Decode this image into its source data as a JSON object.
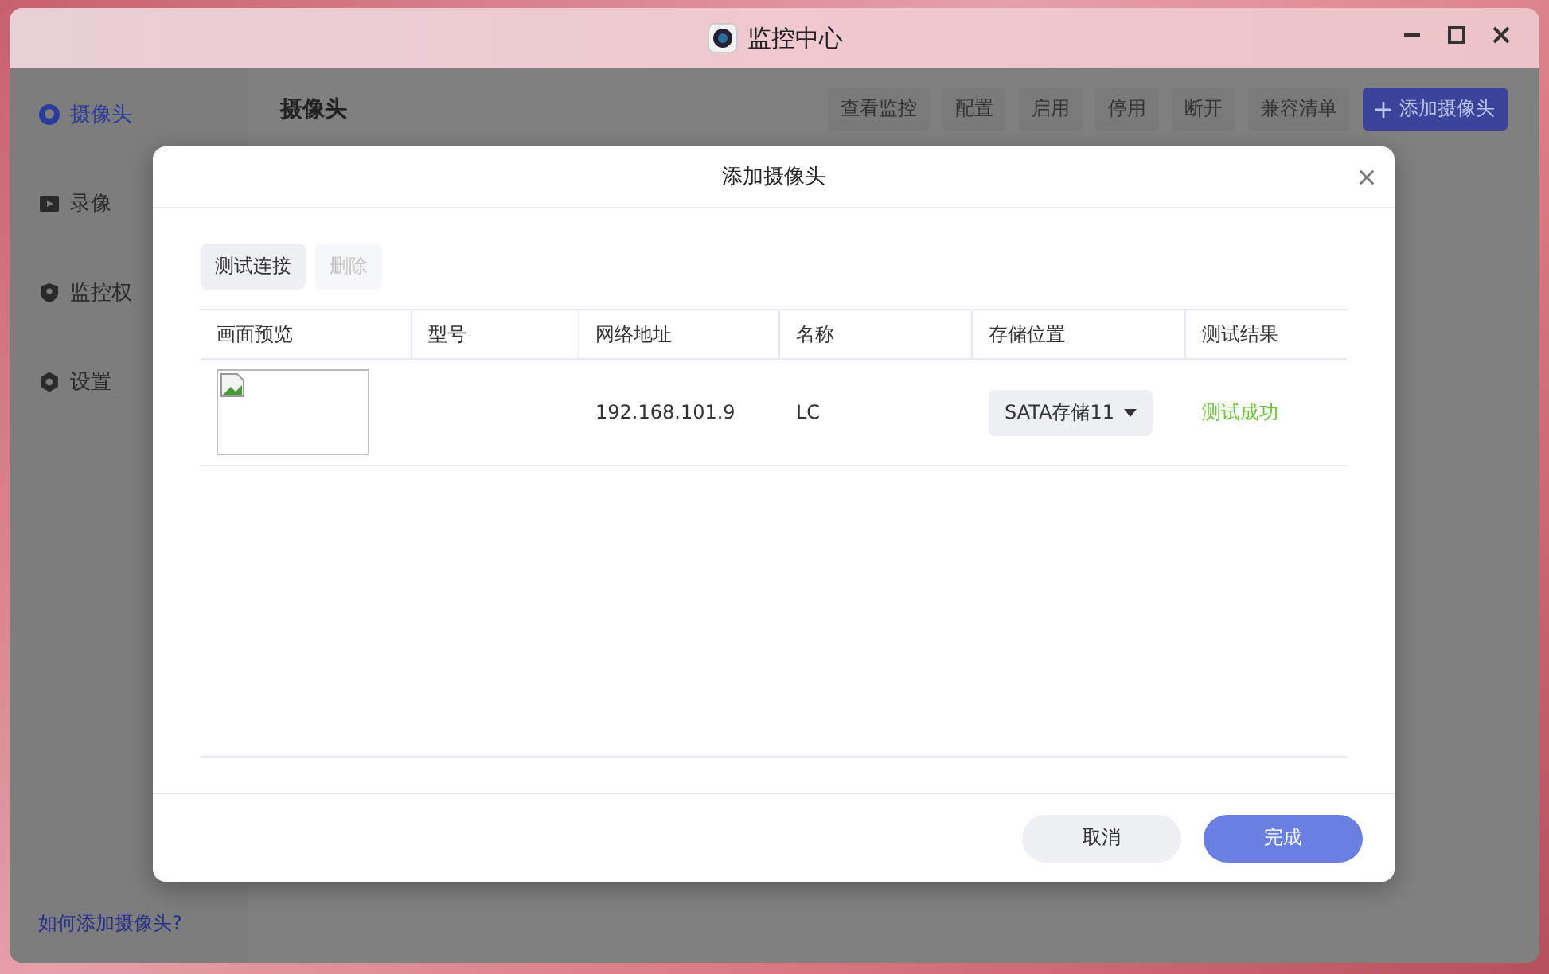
{
  "window": {
    "title": "监控中心"
  },
  "sidebar": {
    "items": [
      {
        "label": "摄像头",
        "kind": "camera",
        "selected": true
      },
      {
        "label": "录像",
        "kind": "video",
        "selected": false
      },
      {
        "label": "监控权",
        "kind": "shield",
        "selected": false
      },
      {
        "label": "设置",
        "kind": "gear",
        "selected": false
      }
    ],
    "help_link": "如何添加摄像头?"
  },
  "header": {
    "title": "摄像头",
    "buttons": [
      {
        "label": "查看监控",
        "kind": "plain"
      },
      {
        "label": "配置",
        "kind": "plain"
      },
      {
        "label": "启用",
        "kind": "plain"
      },
      {
        "label": "停用",
        "kind": "plain"
      },
      {
        "label": "断开",
        "kind": "plain"
      },
      {
        "label": "兼容清单",
        "kind": "plain"
      },
      {
        "label": "添加摄像头",
        "kind": "primary"
      }
    ]
  },
  "dialog": {
    "title": "添加摄像头",
    "actions": [
      {
        "label": "测试连接",
        "disabled": false
      },
      {
        "label": "删除",
        "disabled": true
      }
    ],
    "table": {
      "columns": [
        "画面预览",
        "型号",
        "网络地址",
        "名称",
        "存储位置",
        "测试结果"
      ],
      "rows": [
        {
          "address": "192.168.101.9",
          "name": "LC",
          "storage": "SATA存储11",
          "result": "测试成功"
        }
      ]
    },
    "buttons": [
      {
        "label": "取消",
        "kind": "secondary"
      },
      {
        "label": "完成",
        "kind": "primary"
      }
    ]
  }
}
